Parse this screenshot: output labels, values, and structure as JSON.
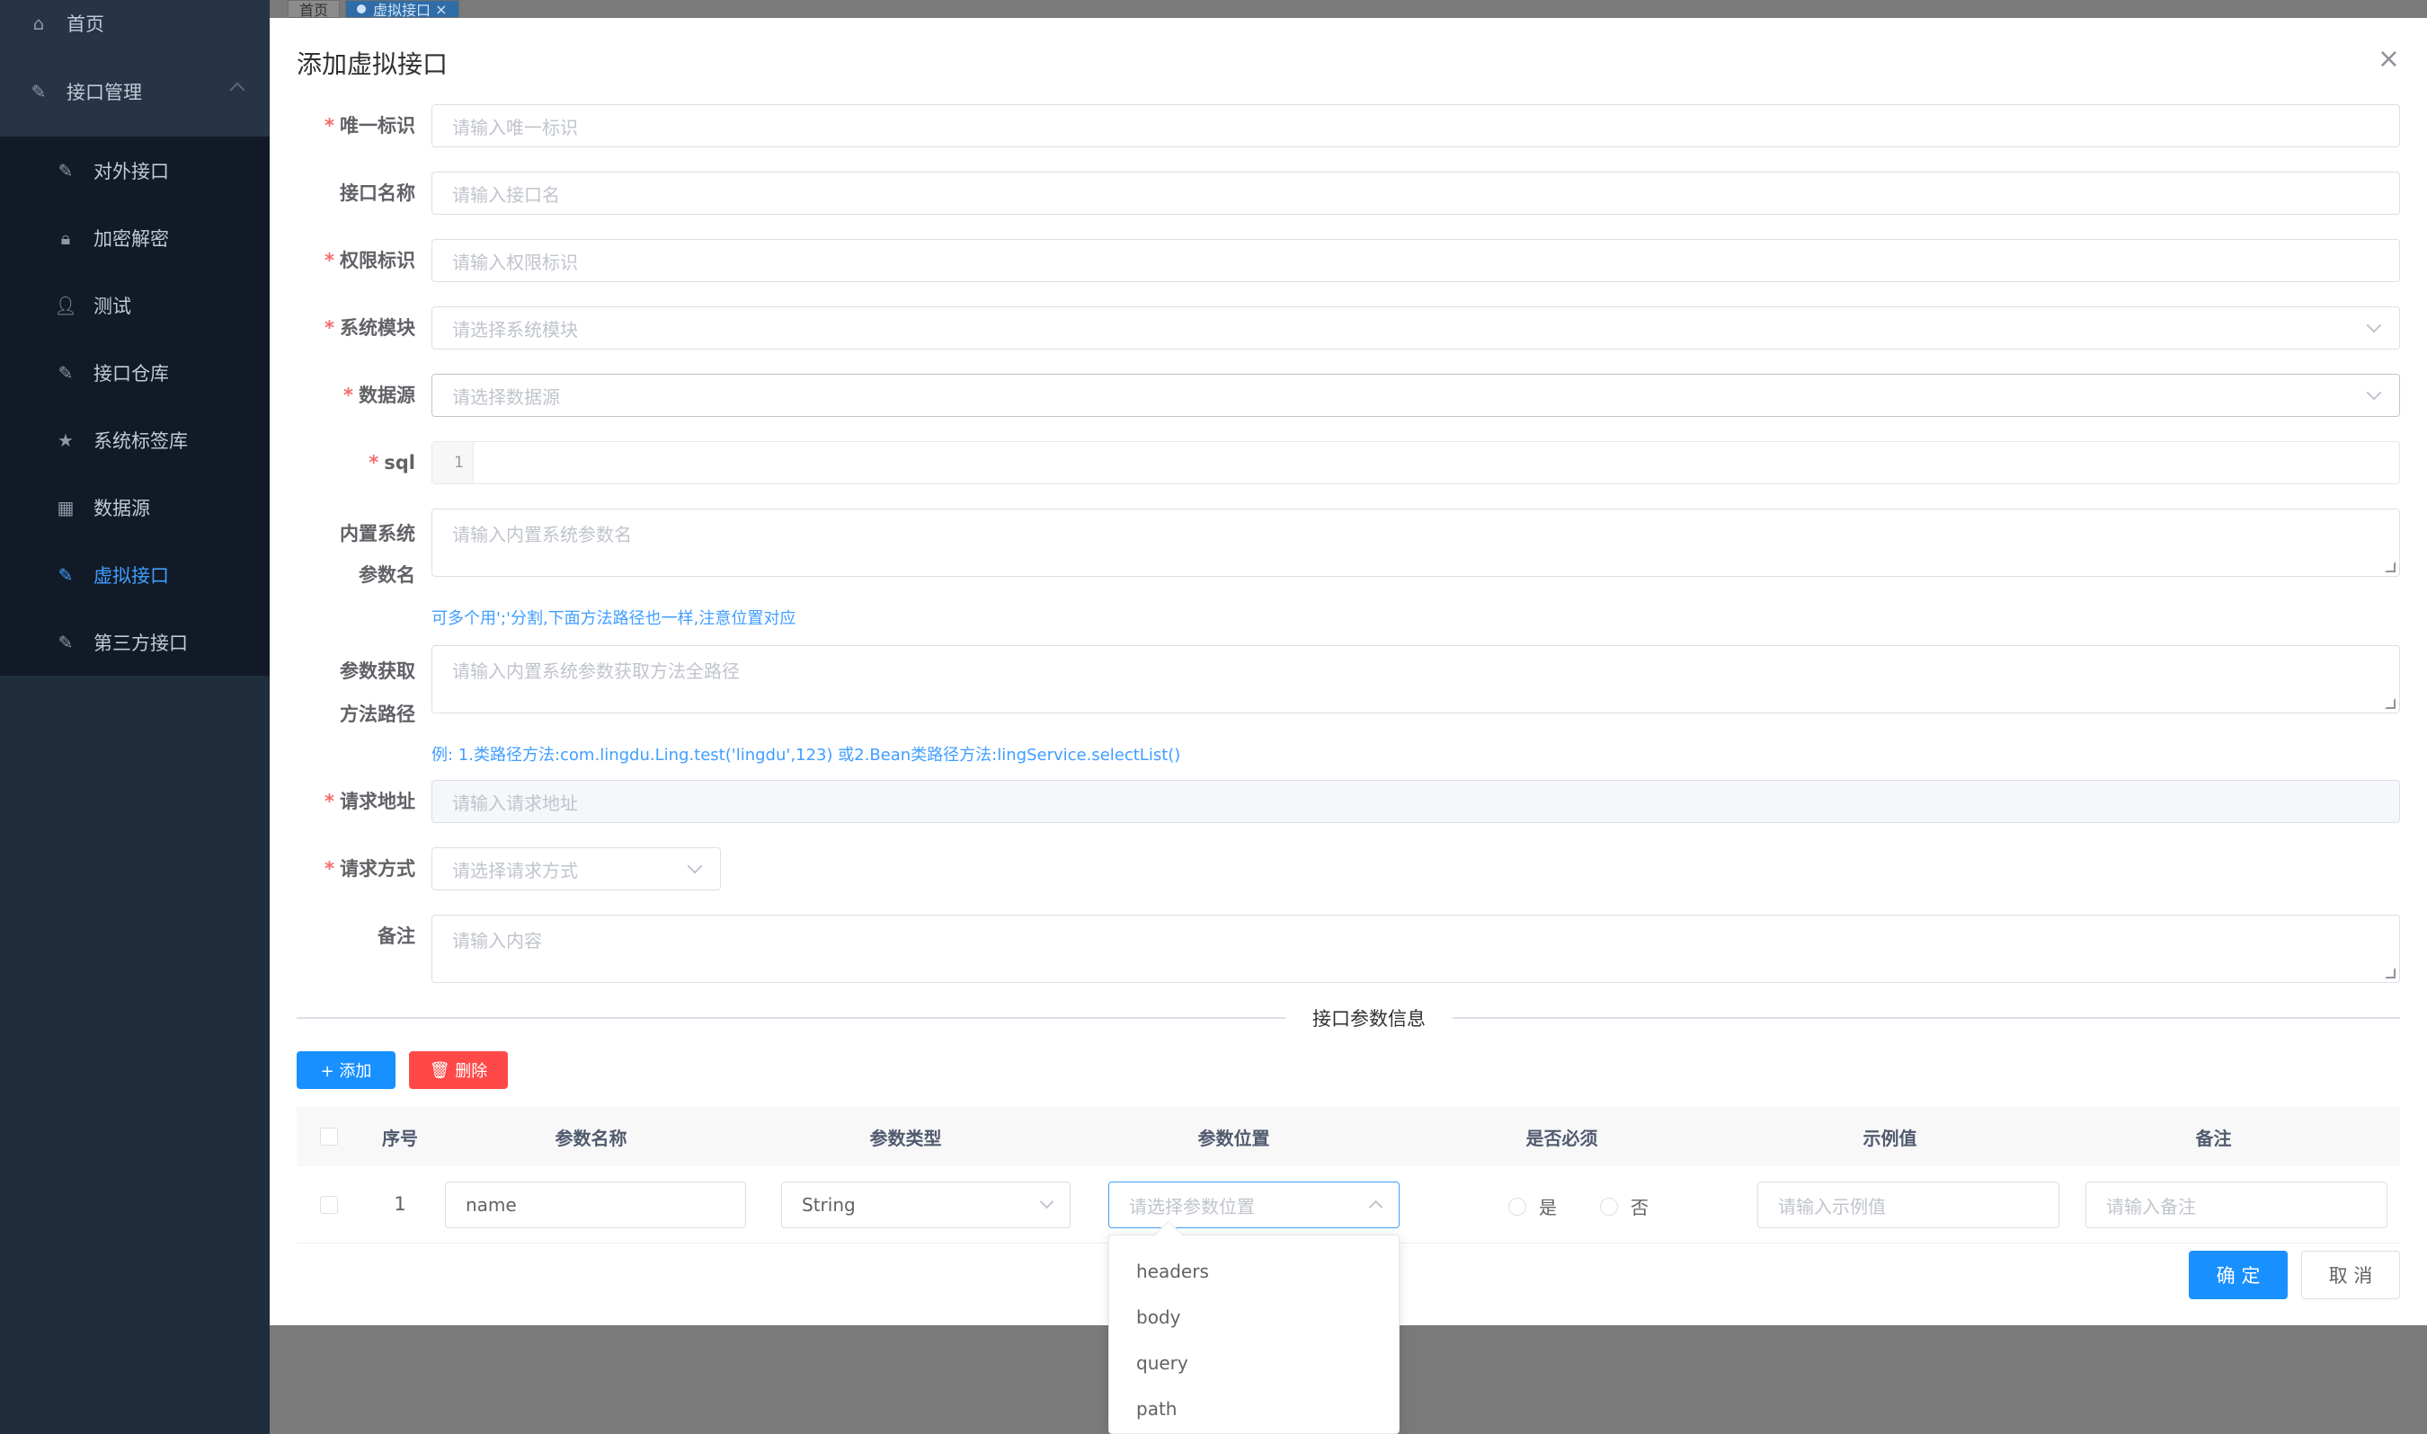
{
  "sidebar": {
    "home": "首页",
    "group": "接口管理",
    "items": [
      {
        "label": "对外接口",
        "icon": "plug-icon"
      },
      {
        "label": "加密解密",
        "icon": "lock-icon"
      },
      {
        "label": "测试",
        "icon": "user-icon"
      },
      {
        "label": "接口仓库",
        "icon": "plug-icon"
      },
      {
        "label": "系统标签库",
        "icon": "star-icon"
      },
      {
        "label": "数据源",
        "icon": "table-icon"
      },
      {
        "label": "虚拟接口",
        "icon": "plug-icon",
        "active": true
      },
      {
        "label": "第三方接口",
        "icon": "plug-icon"
      }
    ]
  },
  "tags": [
    "首页",
    "虚拟接口"
  ],
  "dialog": {
    "title": "添加虚拟接口",
    "fields": {
      "uid": {
        "label": "唯一标识",
        "placeholder": "请输入唯一标识"
      },
      "name": {
        "label": "接口名称",
        "placeholder": "请输入接口名"
      },
      "perm": {
        "label": "权限标识",
        "placeholder": "请输入权限标识"
      },
      "module": {
        "label": "系统模块",
        "placeholder": "请选择系统模块"
      },
      "datasource": {
        "label": "数据源",
        "placeholder": "请选择数据源"
      },
      "sql": {
        "label": "sql",
        "line": "1"
      },
      "builtin": {
        "label1": "内置系统",
        "label2": "参数名",
        "placeholder": "请输入内置系统参数名",
        "hint": "可多个用';'分割,下面方法路径也一样,注意位置对应"
      },
      "method": {
        "label1": "参数获取",
        "label2": "方法路径",
        "placeholder": "请输入内置系统参数获取方法全路径",
        "hint": "例: 1.类路径方法:com.lingdu.Ling.test('lingdu',123) 或2.Bean类路径方法:lingService.selectList()"
      },
      "url": {
        "label": "请求地址",
        "placeholder": "请输入请求地址"
      },
      "httpmethod": {
        "label": "请求方式",
        "placeholder": "请选择请求方式"
      },
      "remark": {
        "label": "备注",
        "placeholder": "请输入内容"
      }
    },
    "divider": "接口参数信息",
    "add_btn": "+ 添加",
    "del_btn": "删除",
    "table": {
      "headers": [
        "序号",
        "参数名称",
        "参数类型",
        "参数位置",
        "是否必须",
        "示例值",
        "备注"
      ],
      "row": {
        "index": "1",
        "name": "name",
        "type": "String",
        "position_placeholder": "请选择参数位置",
        "yes": "是",
        "no": "否",
        "example_placeholder": "请输入示例值",
        "remark_placeholder": "请输入备注"
      }
    },
    "dropdown": [
      "headers",
      "body",
      "query",
      "path"
    ],
    "ok": "确 定",
    "cancel": "取 消"
  }
}
